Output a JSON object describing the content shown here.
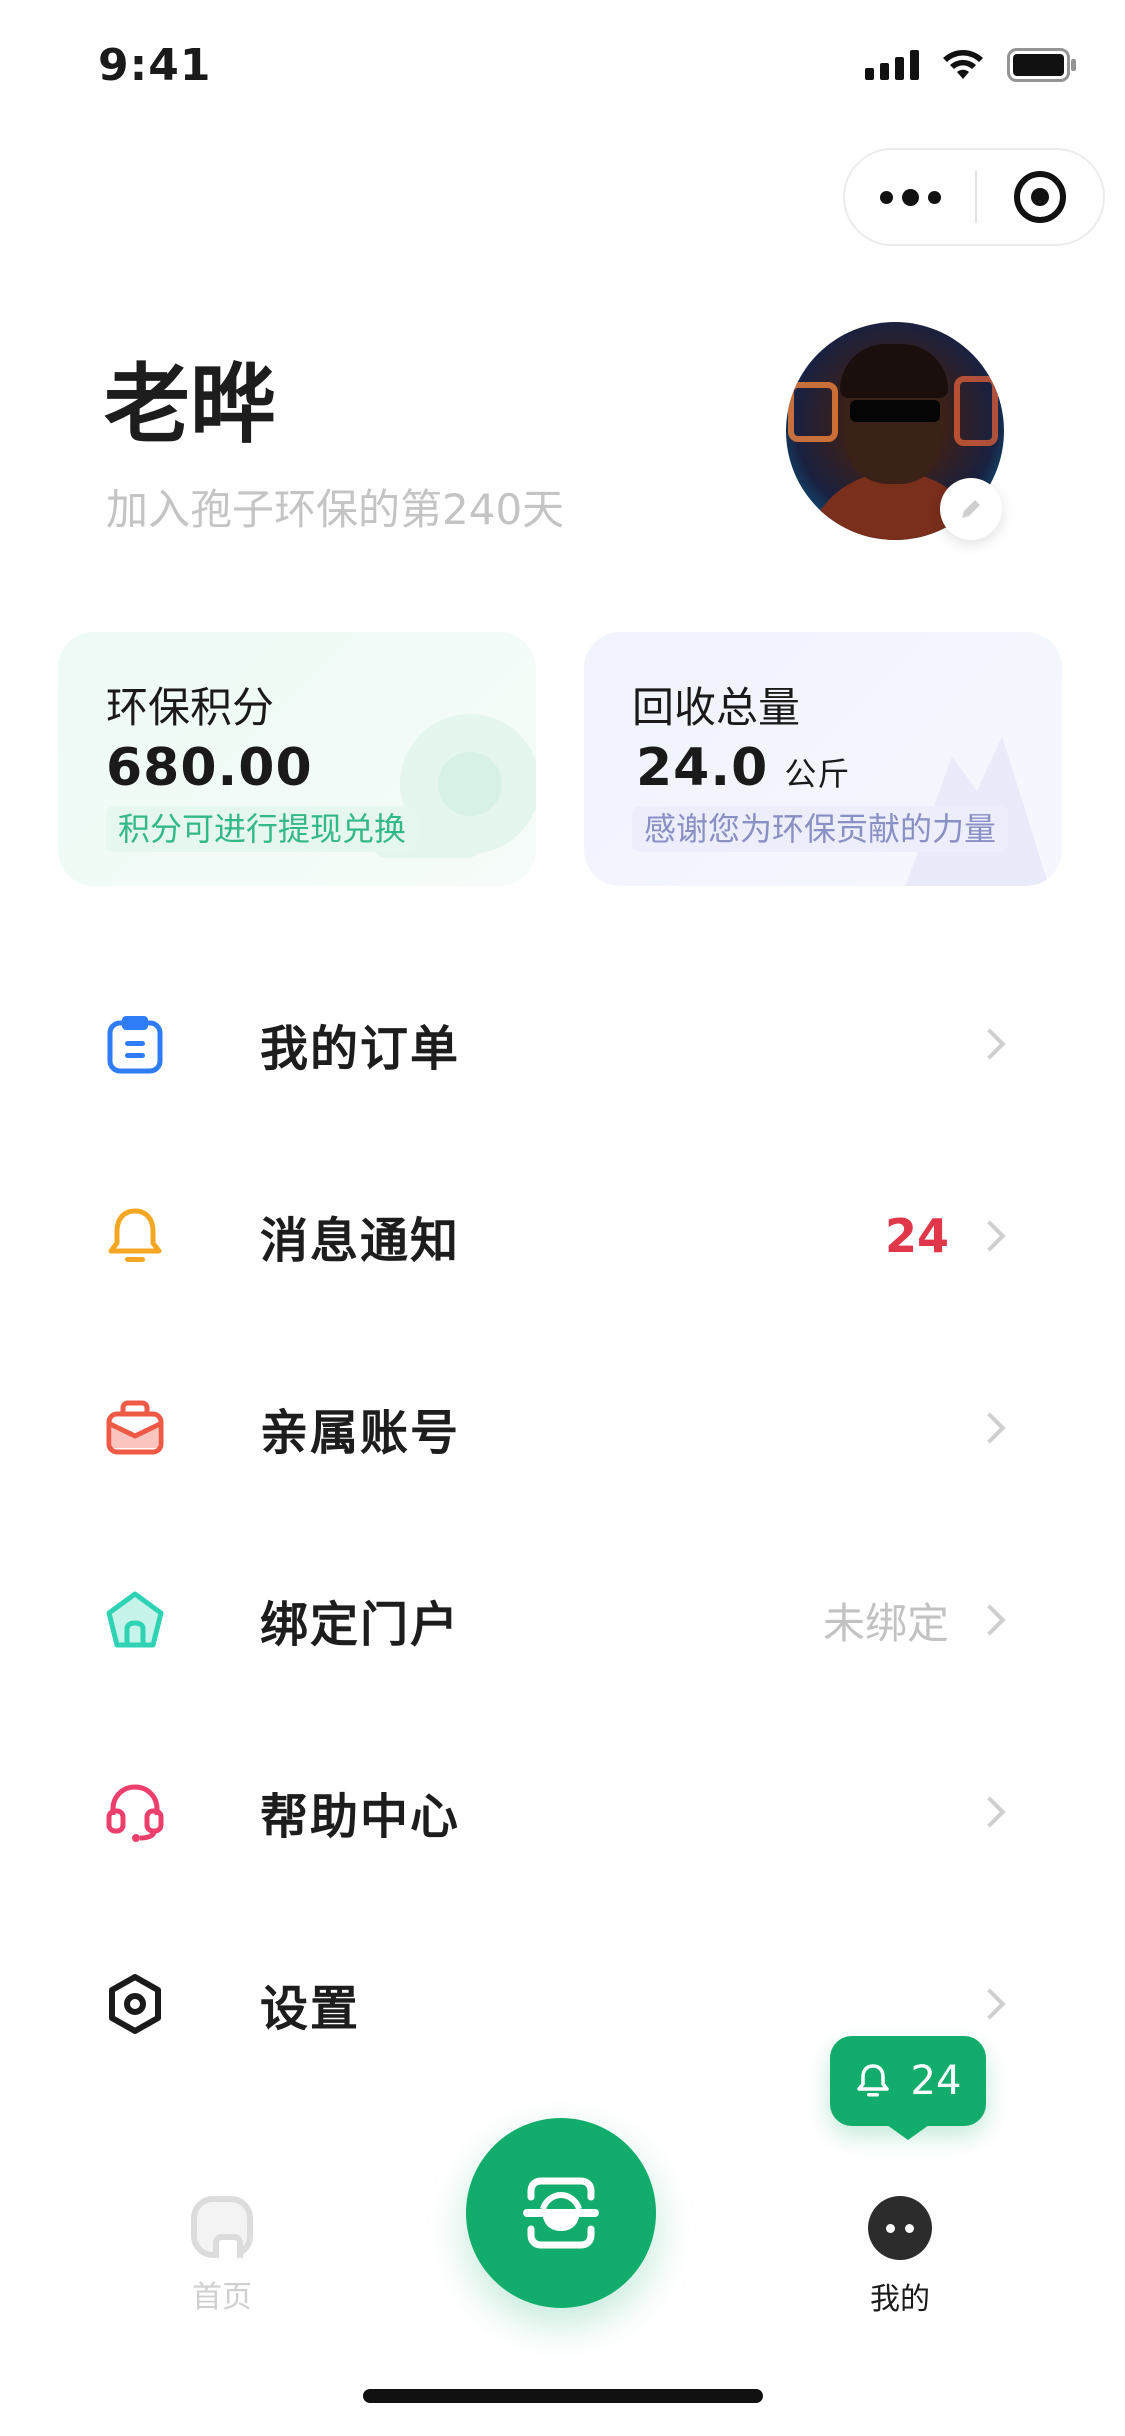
{
  "status_bar": {
    "time": "9:41"
  },
  "profile": {
    "name": "老晔",
    "days_text": "加入孢子环保的第240天"
  },
  "cards": {
    "points": {
      "title": "环保积分",
      "value": "680.00",
      "tag": "积分可进行提现兑换"
    },
    "weight": {
      "title": "回收总量",
      "value": "24.0",
      "unit": "公斤",
      "tag": "感谢您为环保贡献的力量"
    }
  },
  "menu": [
    {
      "label": "我的订单",
      "icon": "clipboard-icon",
      "color": "#2f7df6",
      "right": ""
    },
    {
      "label": "消息通知",
      "icon": "bell-icon",
      "color": "#f5a623",
      "right": "24"
    },
    {
      "label": "亲属账号",
      "icon": "briefcase-icon",
      "color": "#ee5a46",
      "right": ""
    },
    {
      "label": "绑定门户",
      "icon": "house-icon",
      "color": "#2fd3b3",
      "right": "未绑定"
    },
    {
      "label": "帮助中心",
      "icon": "headset-icon",
      "color": "#ec3f6e",
      "right": ""
    },
    {
      "label": "设置",
      "icon": "hexagon-gear-icon",
      "color": "#1a1a1a",
      "right": ""
    }
  ],
  "float_notice": {
    "count": "24"
  },
  "tabbar": {
    "home_label": "首页",
    "mine_label": "我的"
  },
  "colors": {
    "brand_green": "#12ad6c",
    "badge_red": "#e0374b"
  }
}
